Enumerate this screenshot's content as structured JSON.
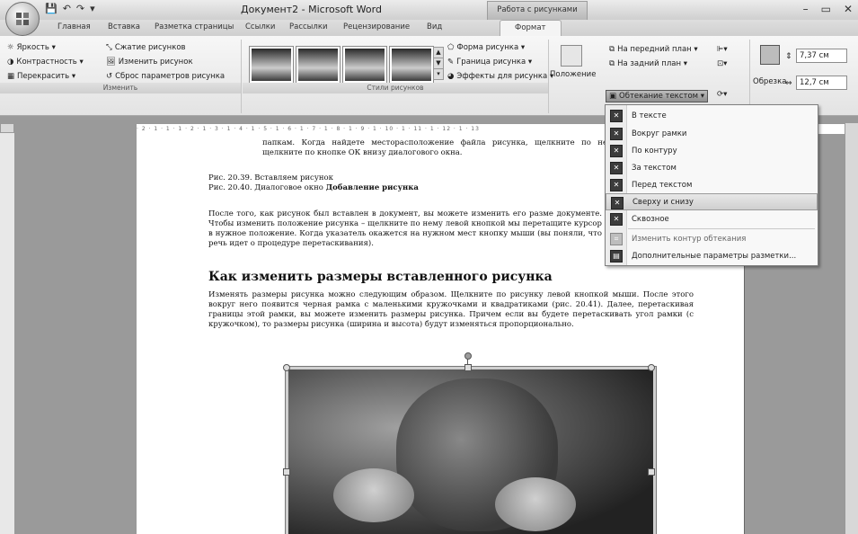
{
  "window": {
    "title": "Документ2 - Microsoft Word",
    "context_tab_title": "Работа с рисунками",
    "controls": [
      "–",
      "▭",
      "✕"
    ]
  },
  "tabs": [
    {
      "label": "Главная"
    },
    {
      "label": "Вставка"
    },
    {
      "label": "Разметка страницы"
    },
    {
      "label": "Ссылки"
    },
    {
      "label": "Рассылки"
    },
    {
      "label": "Рецензирование"
    },
    {
      "label": "Вид"
    },
    {
      "label": "Формат"
    }
  ],
  "ribbon": {
    "adjust": {
      "label": "Изменить",
      "brightness": "Яркость ▾",
      "contrast": "Контрастность ▾",
      "recolor": "Перекрасить ▾",
      "compress": "Сжатие рисунков",
      "change": "Изменить рисунок",
      "reset": "Сброс параметров рисунка"
    },
    "styles": {
      "label": "Стили рисунков",
      "shape": "Форма рисунка ▾",
      "border": "Граница рисунка ▾",
      "effects": "Эффекты для рисунка ▾"
    },
    "arrange": {
      "position": "Положение",
      "front": "На передний план ▾",
      "back": "На задний план ▾",
      "wrap": "Обтекание текстом ▾"
    },
    "size": {
      "crop": "Обрезка",
      "height": "7,37 см",
      "width": "12,7 см"
    }
  },
  "ruler_text": "· 2 · 1 · 1 · 1 · 2 · 1 · 3 · 1 · 4 · 1 · 5 · 1 · 6 · 1 · 7 · 1 · 8 · 1 · 9 · 1 · 10 · 1 · 11 · 1 · 12 · 1 · 13",
  "document": {
    "para1": "папкам. Когда найдете месторасположение файла рисунка, щелкните по не щелкните по кнопке ОК внизу диалогового окна.",
    "caption1": "Рис. 20.39. Вставляем рисунок",
    "caption2_prefix": "Рис. 20.40. Диалоговое окно ",
    "caption2_bold": "Добавление рисунка",
    "para2": "После того, как рисунок был вставлен в документ, вы можете изменить его разме документе. Чтобы изменить положение рисунка – щелкните по нему левой кнопкой мы перетащите курсор в нужное положение. Когда указатель окажется на нужном мест кнопку мыши (вы поняли, что речь идет о процедуре перетаскивания).",
    "heading": "Как изменить размеры вставленного рисунка",
    "para3": "Изменять размеры рисунка можно следующим образом. Щелкните по рисунку левой кнопкой мыши. После этого вокруг него появится черная рамка с маленькими кружочками и квадратиками (рис. 20.41). Далее, перетаскивая границы этой рамки, вы можете изменить размеры рисунка. Причем если вы будете перетаскивать угол рамки (с кружочком), то размеры рисунка (ширина и высота) будут изменяться пропорционально."
  },
  "wrap_menu": {
    "items": [
      {
        "label": "В тексте",
        "icon": "inline-icon"
      },
      {
        "label": "Вокруг рамки",
        "icon": "square-wrap-icon"
      },
      {
        "label": "По контуру",
        "icon": "tight-wrap-icon"
      },
      {
        "label": "За текстом",
        "icon": "behind-text-icon"
      },
      {
        "label": "Перед текстом",
        "icon": "in-front-icon"
      },
      {
        "label": "Сверху и снизу",
        "icon": "top-bottom-icon",
        "highlighted": true
      },
      {
        "label": "Сквозное",
        "icon": "through-icon"
      },
      {
        "label": "Изменить контур обтекания",
        "icon": "edit-points-icon",
        "disabled": true
      },
      {
        "label": "Дополнительные параметры разметки...",
        "icon": "more-layout-icon"
      }
    ]
  }
}
